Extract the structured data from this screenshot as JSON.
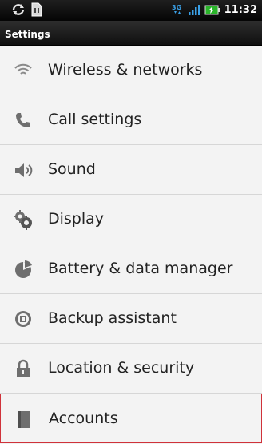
{
  "status_bar": {
    "time": "11:32",
    "network": "3G",
    "icons": [
      "sync-icon",
      "sim-card-icon",
      "network-3g-icon",
      "signal-strength-icon",
      "battery-charging-icon"
    ]
  },
  "header": {
    "title": "Settings"
  },
  "settings": {
    "items": [
      {
        "label": "Wireless & networks",
        "icon": "wifi-icon"
      },
      {
        "label": "Call settings",
        "icon": "phone-icon"
      },
      {
        "label": "Sound",
        "icon": "speaker-icon"
      },
      {
        "label": "Display",
        "icon": "display-gear-icon"
      },
      {
        "label": "Battery & data manager",
        "icon": "pie-chart-icon"
      },
      {
        "label": "Backup assistant",
        "icon": "backup-icon"
      },
      {
        "label": "Location & security",
        "icon": "lock-icon"
      },
      {
        "label": "Accounts",
        "icon": "accounts-icon"
      }
    ]
  },
  "colors": {
    "status_bar_bg": "#050505",
    "list_bg": "#f3f3f3",
    "selection_border": "#d0323a",
    "text": "#222222"
  }
}
